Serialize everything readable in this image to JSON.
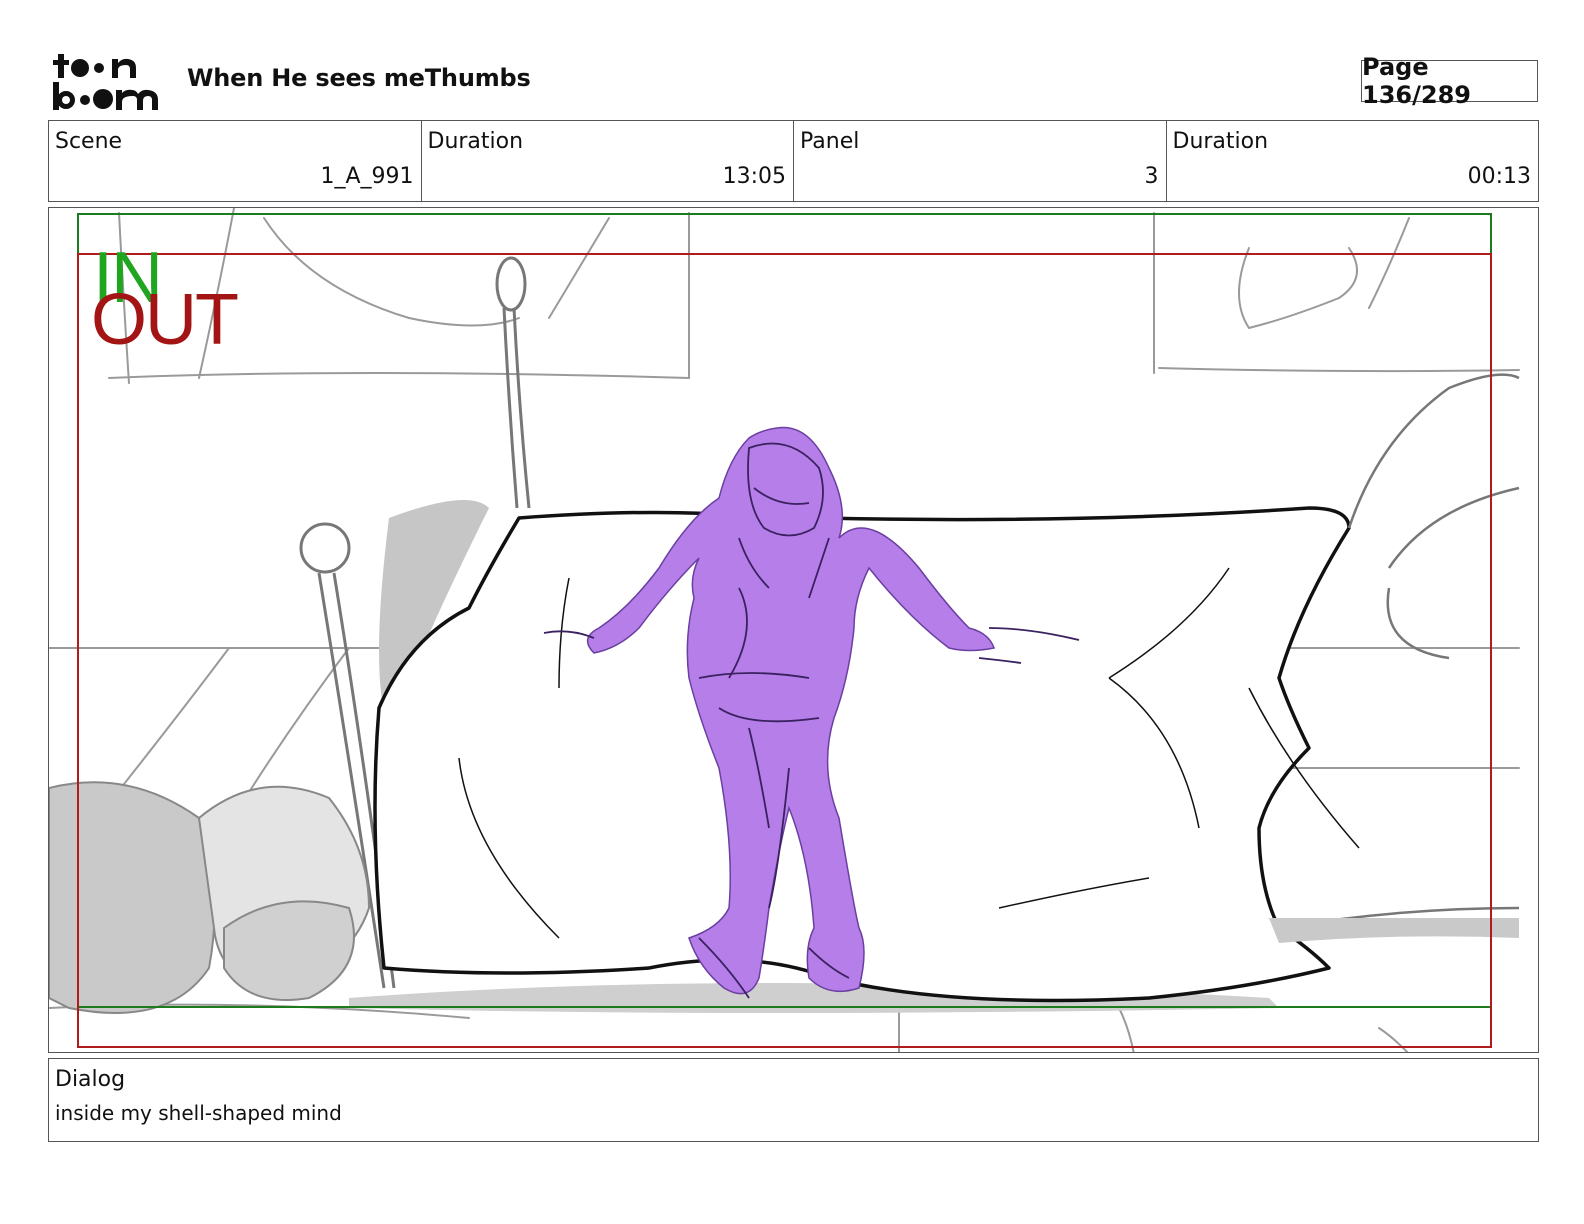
{
  "header": {
    "logo_text": "toon boom",
    "title": "When He sees meThumbs",
    "page": "Page 136/289"
  },
  "info": {
    "scene_label": "Scene",
    "scene_value": "1_A_991",
    "scene_duration_label": "Duration",
    "scene_duration_value": "13:05",
    "panel_label": "Panel",
    "panel_value": "3",
    "panel_duration_label": "Duration",
    "panel_duration_value": "00:13"
  },
  "panel": {
    "in_label": "IN",
    "out_label": "OUT",
    "in_color": "#1fa51f",
    "out_color": "#a31515",
    "character_color": "#b57ee8"
  },
  "dialog": {
    "label": "Dialog",
    "text": "inside my shell-shaped mind"
  }
}
